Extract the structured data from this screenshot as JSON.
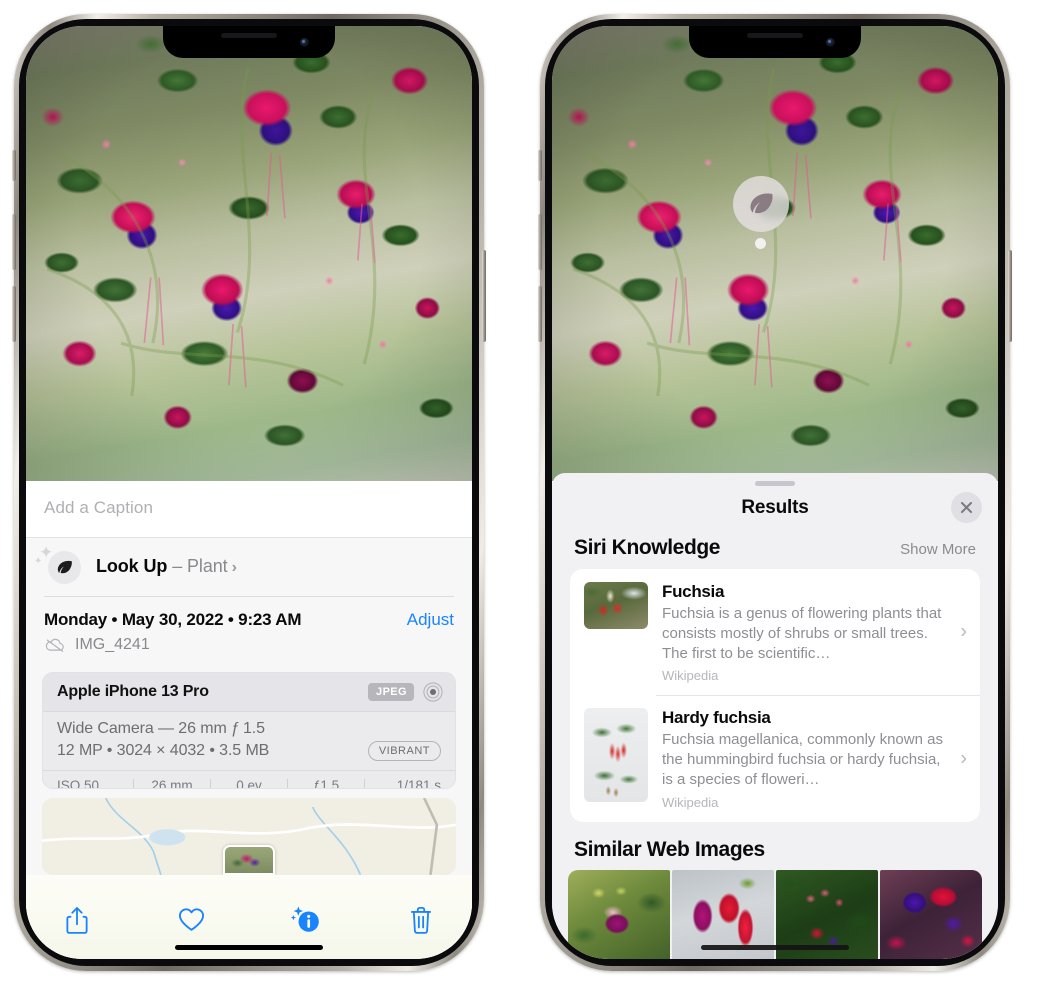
{
  "left_phone": {
    "photo": {
      "alt": "fuchsia-flowers-photo"
    },
    "caption_placeholder": "Add a Caption",
    "lookup": {
      "label": "Look Up",
      "dash": "–",
      "subject": "Plant",
      "chevron": "›",
      "icon": "leaf-icon"
    },
    "meta": {
      "date": "Monday • May 30, 2022 • 9:23 AM",
      "adjust_label": "Adjust",
      "filename": "IMG_4241",
      "cloud_icon": "cloud-slash-icon"
    },
    "exif": {
      "device": "Apple iPhone 13 Pro",
      "format_badge": "JPEG",
      "raw_icon": "raw-ring-icon",
      "lens": "Wide Camera — 26 mm ƒ 1.5",
      "dimensions": "12 MP • 3024 × 4032 • 3.5 MB",
      "style_badge": "VIBRANT",
      "stats": [
        "ISO 50",
        "26 mm",
        "0 ev",
        "ƒ1.5",
        "1/181 s"
      ]
    },
    "map": {
      "name": "location-map",
      "pin": "photo-pin"
    },
    "toolbar": [
      {
        "name": "share-button",
        "icon": "share-icon"
      },
      {
        "name": "favorite-button",
        "icon": "heart-icon"
      },
      {
        "name": "info-button",
        "icon": "info-sparkle-icon"
      },
      {
        "name": "delete-button",
        "icon": "trash-icon"
      }
    ]
  },
  "right_phone": {
    "photo_badge": {
      "icon": "leaf-icon",
      "name": "visual-lookup-leaf-badge"
    },
    "results": {
      "title": "Results",
      "close_icon": "close-icon",
      "siri_knowledge": {
        "heading": "Siri Knowledge",
        "show_more": "Show More",
        "items": [
          {
            "title": "Fuchsia",
            "description": "Fuchsia is a genus of flowering plants that consists mostly of shrubs or small trees. The first to be scientific…",
            "source": "Wikipedia",
            "thumb": "fuchsia-red-flowers-thumb"
          },
          {
            "title": "Hardy fuchsia",
            "description": "Fuchsia magellanica, commonly known as the hummingbird fuchsia or hardy fuchsia, is a species of floweri…",
            "source": "Wikipedia",
            "thumb": "hardy-fuchsia-specimen-thumb"
          }
        ]
      },
      "similar_web_images": {
        "heading": "Similar Web Images",
        "items": [
          {
            "name": "similar-image-1"
          },
          {
            "name": "similar-image-2"
          },
          {
            "name": "similar-image-3"
          },
          {
            "name": "similar-image-4"
          }
        ]
      }
    }
  },
  "colors": {
    "accent_blue": "#1a84ff",
    "sheet_bg": "#f1f1f4",
    "card_bg": "#ffffff",
    "muted_text": "#8e8e94"
  }
}
